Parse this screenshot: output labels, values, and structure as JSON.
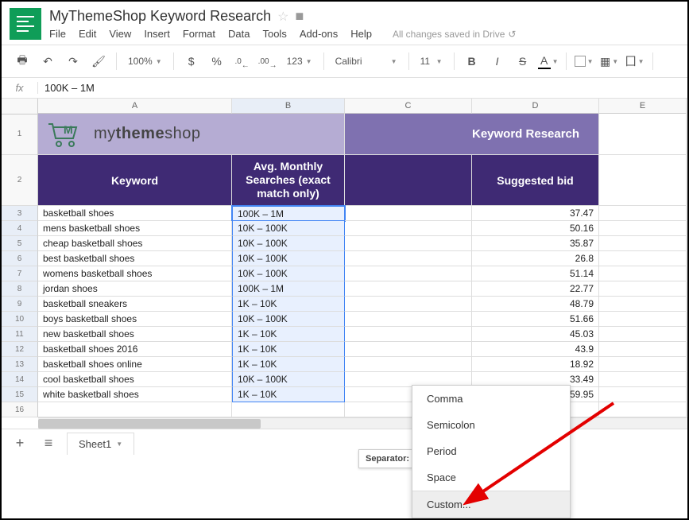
{
  "doc_title": "MyThemeShop Keyword Research",
  "menus": [
    "File",
    "Edit",
    "View",
    "Insert",
    "Format",
    "Data",
    "Tools",
    "Add-ons",
    "Help"
  ],
  "save_status": "All changes saved in Drive",
  "toolbar": {
    "zoom": "100%",
    "currency": "$",
    "percent": "%",
    "dec_dec": ".0",
    "dec_inc": ".00",
    "numfmt": "123",
    "font": "Calibri",
    "size": "11"
  },
  "formula_value": "100K – 1M",
  "columns": [
    "A",
    "B",
    "C",
    "D",
    "E"
  ],
  "merged_header": {
    "brand": "mythemeshop",
    "research": "Keyword Research"
  },
  "table_headers": {
    "a": "Keyword",
    "b": "Avg. Monthly Searches (exact match only)",
    "c": "",
    "d": "Suggested bid"
  },
  "rows": [
    {
      "n": 3,
      "a": "basketball shoes",
      "b": "100K – 1M",
      "d": "37.47"
    },
    {
      "n": 4,
      "a": "mens basketball shoes",
      "b": "10K – 100K",
      "d": "50.16"
    },
    {
      "n": 5,
      "a": "cheap basketball shoes",
      "b": "10K – 100K",
      "d": "35.87"
    },
    {
      "n": 6,
      "a": "best basketball shoes",
      "b": "10K – 100K",
      "d": "26.8"
    },
    {
      "n": 7,
      "a": "womens basketball shoes",
      "b": "10K – 100K",
      "d": "51.14"
    },
    {
      "n": 8,
      "a": "jordan shoes",
      "b": "100K – 1M",
      "d": "22.77"
    },
    {
      "n": 9,
      "a": "basketball sneakers",
      "b": "1K – 10K",
      "d": "48.79"
    },
    {
      "n": 10,
      "a": "boys basketball shoes",
      "b": "10K – 100K",
      "d": "51.66"
    },
    {
      "n": 11,
      "a": "new basketball shoes",
      "b": "1K – 10K",
      "d": "45.03"
    },
    {
      "n": 12,
      "a": "basketball shoes 2016",
      "b": "1K – 10K",
      "d": "43.9"
    },
    {
      "n": 13,
      "a": "basketball shoes online",
      "b": "1K – 10K",
      "d": "18.92"
    },
    {
      "n": 14,
      "a": "cool basketball shoes",
      "b": "10K – 100K",
      "d": "33.49"
    },
    {
      "n": 15,
      "a": "white basketball shoes",
      "b": "1K – 10K",
      "d": "59.95"
    }
  ],
  "empty_row": 16,
  "separator_label": "Separator:",
  "popup": [
    "Comma",
    "Semicolon",
    "Period",
    "Space",
    "Custom..."
  ],
  "sheet_tab": "Sheet1"
}
